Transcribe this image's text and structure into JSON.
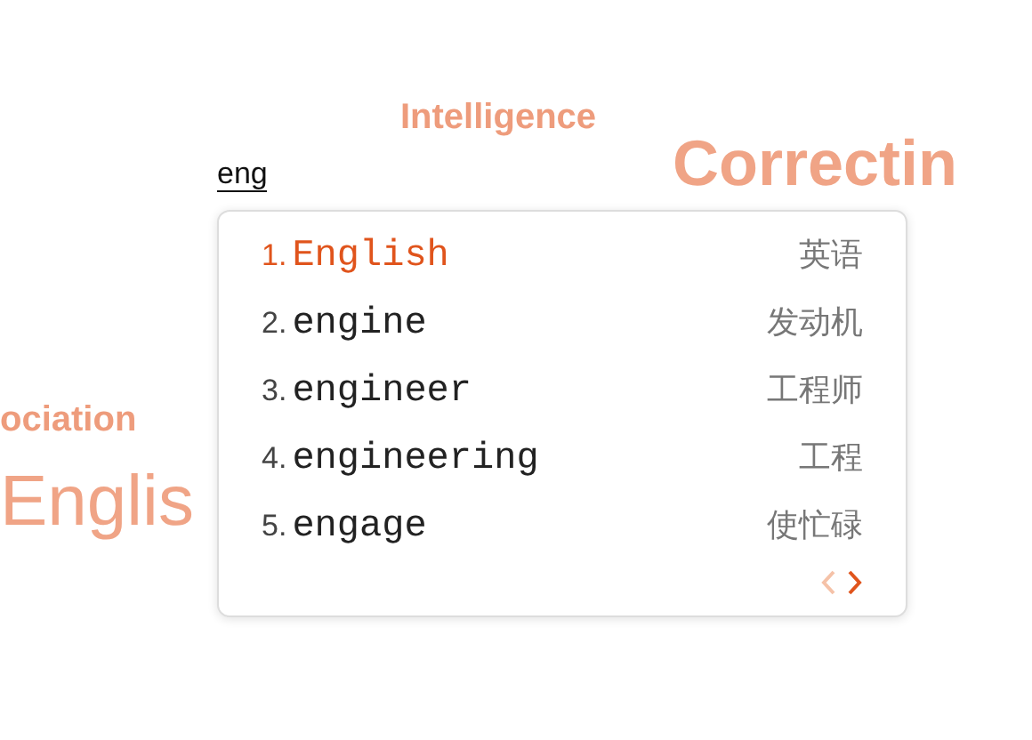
{
  "background_words": [
    {
      "text": "Intelligence",
      "kind": "small"
    },
    {
      "text": "Correctin",
      "kind": "large"
    },
    {
      "text": "ociation",
      "kind": "small"
    },
    {
      "text": "Englis",
      "kind": "huge"
    }
  ],
  "input": {
    "value": "eng"
  },
  "candidates": [
    {
      "number": "1.",
      "word": "English",
      "translation": "英语",
      "selected": true
    },
    {
      "number": "2.",
      "word": "engine",
      "translation": "发动机",
      "selected": false
    },
    {
      "number": "3.",
      "word": "engineer",
      "translation": "工程师",
      "selected": false
    },
    {
      "number": "4.",
      "word": "engineering",
      "translation": "工程",
      "selected": false
    },
    {
      "number": "5.",
      "word": "engage",
      "translation": "使忙碌",
      "selected": false
    }
  ],
  "pager": {
    "previous_disabled": true,
    "next_disabled": false
  }
}
